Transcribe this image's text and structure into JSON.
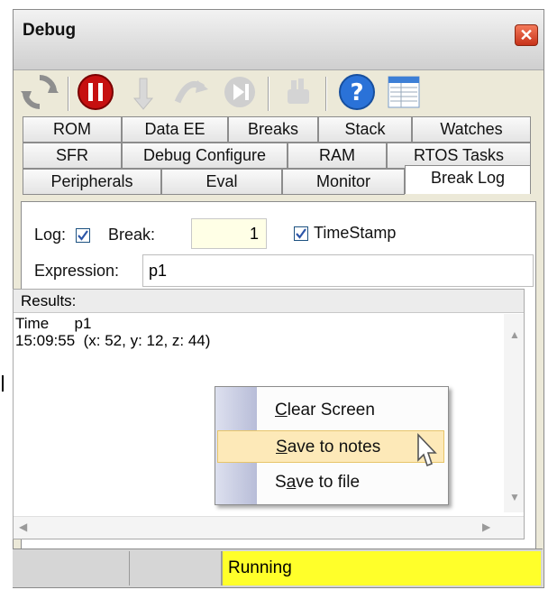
{
  "window": {
    "title": "Debug",
    "close_icon": "close-icon"
  },
  "toolbar": {
    "buttons": [
      {
        "name": "refresh-icon",
        "enabled": true
      },
      {
        "name": "stop-icon",
        "enabled": true
      },
      {
        "name": "step-into-icon",
        "enabled": false
      },
      {
        "name": "step-over-icon",
        "enabled": false
      },
      {
        "name": "run-to-cursor-icon",
        "enabled": false
      },
      {
        "name": "reset-icon",
        "enabled": false
      },
      {
        "name": "help-icon",
        "enabled": true
      },
      {
        "name": "watch-window-icon",
        "enabled": true
      }
    ]
  },
  "tabs": {
    "row1": [
      "ROM",
      "Data EE",
      "Breaks",
      "Stack",
      "Watches"
    ],
    "row2": [
      "SFR",
      "Debug Configure",
      "RAM",
      "RTOS Tasks"
    ],
    "row3": [
      "Peripherals",
      "Eval",
      "Monitor",
      "Break Log"
    ],
    "active": "Break Log"
  },
  "breaklog": {
    "log_label": "Log:",
    "log_checked": true,
    "break_label": "Break:",
    "break_value": "1",
    "timestamp_label": "TimeStamp",
    "timestamp_checked": true,
    "expression_label": "Expression:",
    "expression_value": "p1"
  },
  "results": {
    "header": "Results:",
    "line1": "Time      p1",
    "line2": "15:09:55  (x: 52, y: 12, z: 44)"
  },
  "context_menu": {
    "items": [
      {
        "label": "Clear Screen",
        "hotkey": "C",
        "rest": "lear Screen",
        "highlighted": false
      },
      {
        "label": "Save to notes",
        "hotkey": "S",
        "rest": "ave to notes",
        "highlighted": true
      },
      {
        "label": "Save to file",
        "pre": "S",
        "hotkey": "a",
        "rest": "ve to file",
        "highlighted": false
      }
    ]
  },
  "status": {
    "text": "Running",
    "color": "#ffff2a"
  }
}
